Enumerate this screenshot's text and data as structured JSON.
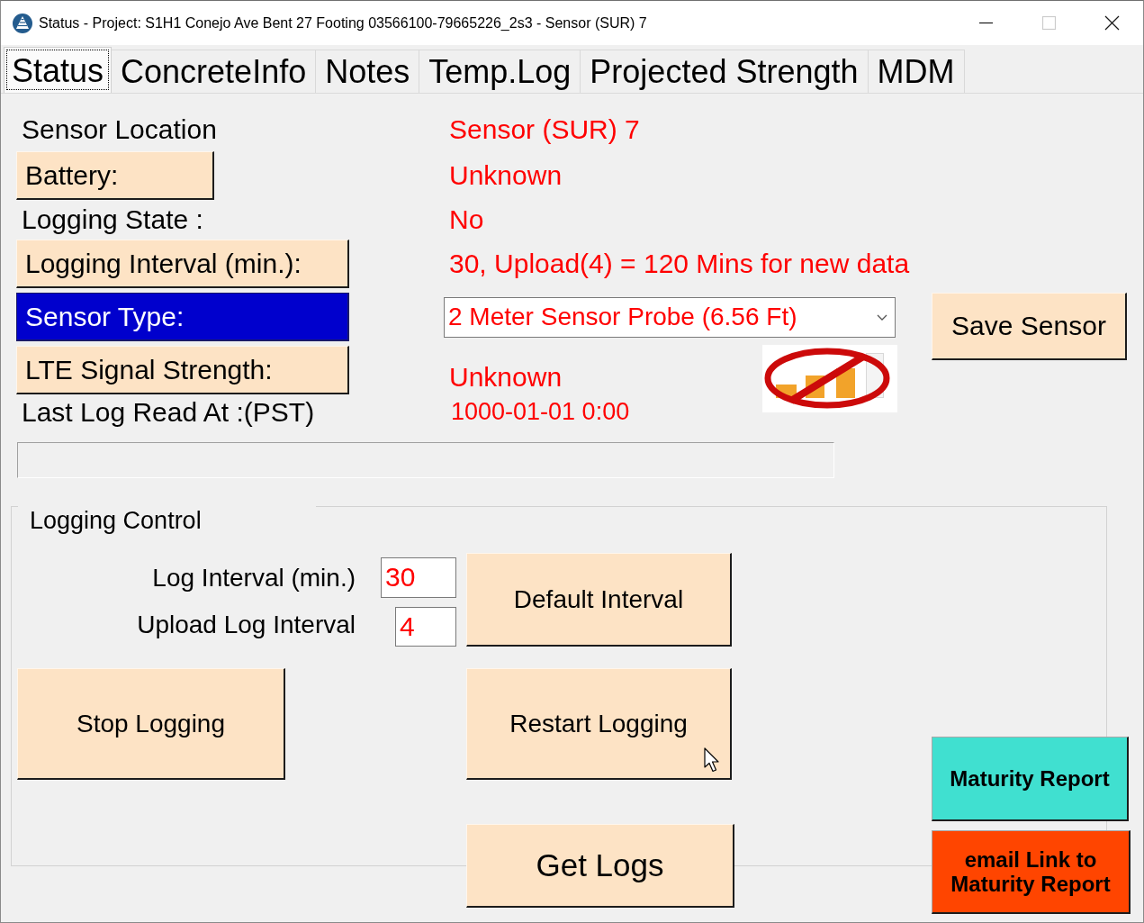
{
  "window": {
    "title": "Status - Project: S1H1 Conejo Ave Bent 27 Footing 03566100-79665226_2s3 - Sensor (SUR) 7",
    "controls": [
      {
        "kind": "minimize",
        "disabled": false
      },
      {
        "kind": "maximize",
        "disabled": true
      },
      {
        "kind": "close",
        "disabled": false
      }
    ]
  },
  "tabs": [
    {
      "label": "Status",
      "selected": true
    },
    {
      "label": "ConcreteInfo",
      "selected": false
    },
    {
      "label": "Notes",
      "selected": false
    },
    {
      "label": "Temp.Log",
      "selected": false
    },
    {
      "label": "Projected Strength",
      "selected": false
    },
    {
      "label": "MDM",
      "selected": false
    }
  ],
  "sensor_rows": [
    {
      "label": {
        "kind": "text",
        "text": "Sensor Location",
        "highlighted": false
      },
      "value": {
        "kind": "text",
        "text": "Sensor (SUR) 7"
      }
    },
    {
      "label": {
        "kind": "button",
        "text": "Battery:",
        "highlighted": false
      },
      "value": {
        "kind": "text",
        "text": "Unknown"
      }
    },
    {
      "label": {
        "kind": "text",
        "text": "Logging State :",
        "highlighted": false
      },
      "value": {
        "kind": "text",
        "text": "No"
      }
    },
    {
      "label": {
        "kind": "button",
        "text": "Logging Interval (min.):",
        "highlighted": false
      },
      "value": {
        "kind": "text",
        "text": "30, Upload(4) = 120 Mins for new data"
      }
    },
    {
      "label": {
        "kind": "button",
        "text": "Sensor Type:",
        "highlighted": true
      },
      "value": {
        "kind": "dropdown",
        "text": "2 Meter Sensor Probe (6.56 Ft)"
      }
    },
    {
      "label": {
        "kind": "button",
        "text": "LTE Signal Strength:",
        "highlighted": false
      },
      "value": {
        "kind": "text",
        "text": "Unknown"
      }
    },
    {
      "label": {
        "kind": "text",
        "text": "Last Log Read At :(PST)",
        "highlighted": false
      },
      "value": {
        "kind": "text",
        "text": "1000-01-01 0:00"
      }
    }
  ],
  "save_button": "Save Sensor",
  "logging_control": {
    "title": "Logging Control",
    "fields": [
      {
        "label": "Log Interval (min.)",
        "value": "30"
      },
      {
        "label": "Upload Log Interval",
        "value": "4"
      }
    ],
    "buttons": [
      "Default Interval",
      "Stop Logging",
      "Restart Logging"
    ]
  },
  "get_logs_button": "Get Logs",
  "report_buttons": [
    {
      "label": "Maturity Report",
      "color": "#40e0d0"
    },
    {
      "label": "email Link to Maturity Report",
      "color": "#ff4500"
    }
  ]
}
